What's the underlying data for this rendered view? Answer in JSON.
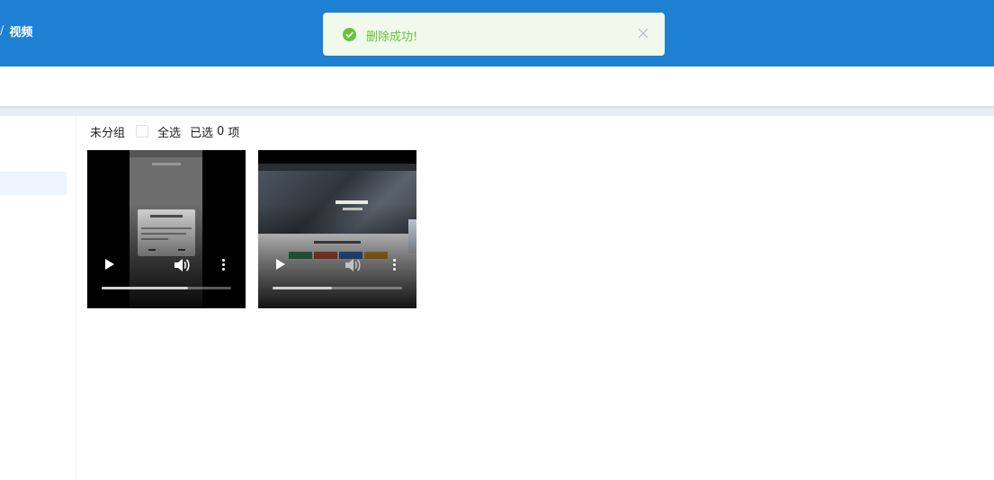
{
  "breadcrumb": {
    "separator": "/",
    "current": "视频"
  },
  "toast": {
    "message": "删除成功!",
    "type": "success",
    "color": "#67c23a"
  },
  "toolbar": {
    "group_label": "未分组",
    "select_all_label": "全选",
    "selected_prefix": "已选",
    "selected_count": "0",
    "selected_suffix": "项"
  },
  "videos": [
    {
      "thumbnail": "mobile-screen-recording",
      "progress": 0.67
    },
    {
      "thumbnail": "website-screen-recording",
      "progress": 0.46
    }
  ],
  "colors": {
    "header": "#1d80d3",
    "toast_bg": "#f0f9eb",
    "menu_active": "#eef5fe"
  }
}
